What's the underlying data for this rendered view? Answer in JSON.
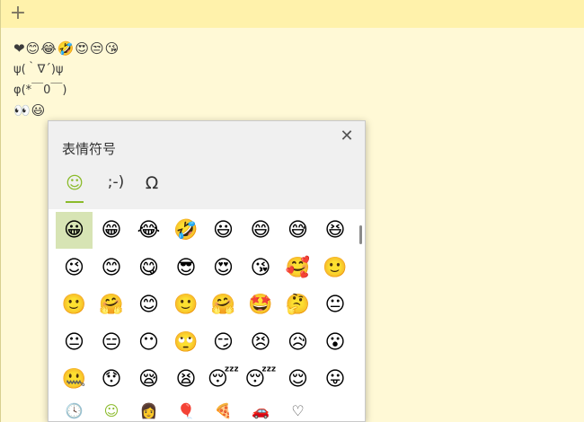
{
  "note": {
    "lines": [
      {
        "text": "❤😊😂🤣😍😒😘",
        "emoji": true
      },
      {
        "text": "ψ(｀∇´)ψ",
        "emoji": false
      },
      {
        "text": "φ(*￣0￣)",
        "emoji": false
      },
      {
        "text": "👀😃",
        "emoji": true
      }
    ]
  },
  "toolbar": {
    "add_icon": "+"
  },
  "emoji_panel": {
    "title": "表情符号",
    "close_icon": "✕",
    "tabs": [
      {
        "name": "emoji",
        "label": "☺",
        "active": true
      },
      {
        "name": "kaomoji",
        "label": ";-)",
        "active": false
      },
      {
        "name": "symbols",
        "label": "Ω",
        "active": false
      }
    ],
    "grid": [
      [
        "😀",
        "😁",
        "😂",
        "🤣",
        "😃",
        "😄",
        "😅",
        "😆"
      ],
      [
        "😉",
        "😊",
        "😋",
        "😎",
        "😍",
        "😘",
        "🥰",
        "🙂"
      ],
      [
        "🙂",
        "🤗",
        "😊",
        "🙂",
        "🤗",
        "🤩",
        "🤔",
        "😐"
      ],
      [
        "😐",
        "😑",
        "😶",
        "🙄",
        "😏",
        "😣",
        "😥",
        "😮"
      ],
      [
        "🤐",
        "😯",
        "😪",
        "😫",
        "😴",
        "😴",
        "😌",
        "😛"
      ]
    ],
    "selected": [
      0,
      0
    ],
    "categories": [
      {
        "name": "recent-icon",
        "label": "🕓",
        "active": false
      },
      {
        "name": "smiley-icon",
        "label": "☺",
        "active": true
      },
      {
        "name": "person-icon",
        "label": "👩",
        "active": false
      },
      {
        "name": "balloon-icon",
        "label": "🎈",
        "active": false
      },
      {
        "name": "pizza-icon",
        "label": "🍕",
        "active": false
      },
      {
        "name": "car-icon",
        "label": "🚗",
        "active": false
      },
      {
        "name": "heart-icon",
        "label": "♡",
        "active": false
      }
    ]
  },
  "colors": {
    "note_background": "#fff9d6",
    "note_header": "#fff2ab",
    "accent": "#8bbb2b"
  }
}
